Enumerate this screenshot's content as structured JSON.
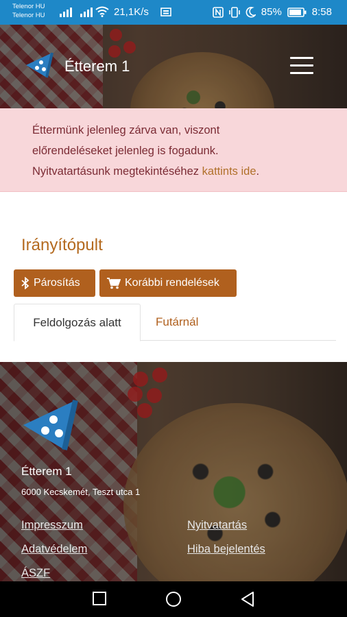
{
  "status_bar": {
    "carrier1": "Telenor HU",
    "carrier2": "Telenor HU",
    "speed": "21,1K/s",
    "battery": "85%",
    "time": "8:58"
  },
  "header": {
    "brand": "Étterem 1"
  },
  "alert": {
    "line1": "Éttermünk jelenleg zárva van, viszont",
    "line2": "előrendeléseket jelenleg is fogadunk.",
    "line3": "Nyitvatartásunk megtekintéséhez",
    "link": "kattints ide",
    "suffix": "."
  },
  "main": {
    "title": "Irányítópult",
    "pair_button": "Párosítás",
    "orders_button": "Korábbi rendelések",
    "tabs": [
      {
        "label": "Feldolgozás alatt"
      },
      {
        "label": "Futárnál"
      }
    ]
  },
  "footer": {
    "name": "Étterem 1",
    "address": "6000 Kecskemét, Teszt utca 1",
    "links": {
      "imprint": "Impresszum",
      "hours": "Nyitvatartás",
      "privacy": "Adatvédelem",
      "report": "Hiba bejelentés",
      "terms": "ÁSZF"
    }
  },
  "colors": {
    "status_bar": "#1e88c8",
    "accent": "#b0601e",
    "alert_bg": "#f8d7da",
    "alert_text": "#7b2b34",
    "logo_blue": "#2b7ec1"
  }
}
